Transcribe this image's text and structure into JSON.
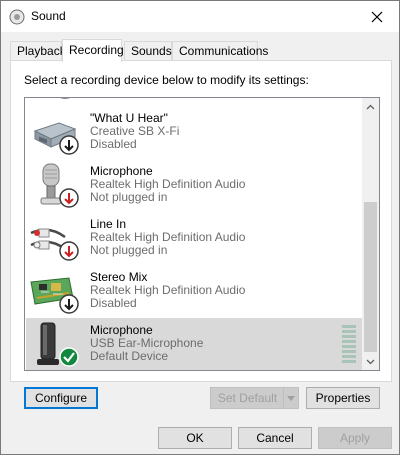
{
  "window": {
    "title": "Sound"
  },
  "tabs": [
    {
      "label": "Playback"
    },
    {
      "label": "Recording"
    },
    {
      "label": "Sounds"
    },
    {
      "label": "Communications"
    }
  ],
  "instruction": "Select a recording device below to modify its settings:",
  "devices": [
    {
      "name": "\"What U Hear\"",
      "line1": "Creative SB X-Fi",
      "line2": "Disabled",
      "icon": "sound-card-icon",
      "status": "disabled"
    },
    {
      "name": "Microphone",
      "line1": "Realtek High Definition Audio",
      "line2": "Not plugged in",
      "icon": "microphone-icon",
      "status": "unplugged"
    },
    {
      "name": "Line In",
      "line1": "Realtek High Definition Audio",
      "line2": "Not plugged in",
      "icon": "line-in-cable-icon",
      "status": "unplugged"
    },
    {
      "name": "Stereo Mix",
      "line1": "Realtek High Definition Audio",
      "line2": "Disabled",
      "icon": "circuit-board-icon",
      "status": "disabled"
    },
    {
      "name": "Microphone",
      "line1": "USB Ear-Microphone",
      "line2": "Default Device",
      "icon": "headset-microphone-icon",
      "status": "default"
    }
  ],
  "buttons": {
    "configure": "Configure",
    "set_default": "Set Default",
    "properties": "Properties",
    "ok": "OK",
    "cancel": "Cancel",
    "apply": "Apply"
  },
  "colors": {
    "selected_row": "#d9d9d9",
    "focus_border": "#0078d7",
    "status_disabled": "#1a1a1a",
    "status_unplugged": "#cc1f1f",
    "status_default": "#10893e"
  }
}
